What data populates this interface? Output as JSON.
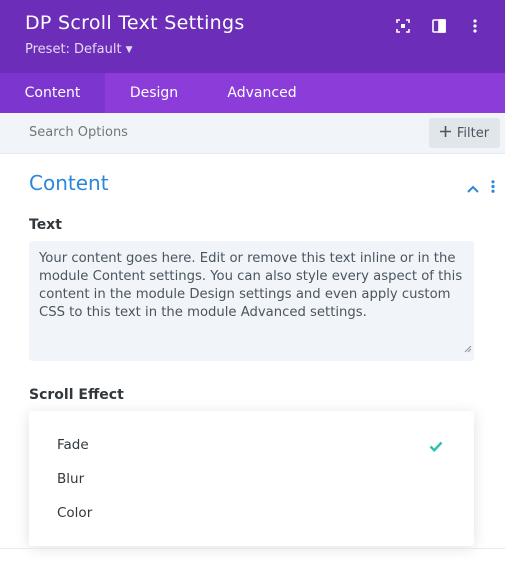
{
  "header": {
    "title": "DP Scroll Text Settings",
    "preset_label": "Preset: Default",
    "icons": [
      "expand-icon",
      "sidebar-toggle-icon",
      "more-vertical-icon"
    ]
  },
  "tabs": [
    {
      "label": "Content",
      "active": true
    },
    {
      "label": "Design",
      "active": false
    },
    {
      "label": "Advanced",
      "active": false
    }
  ],
  "search": {
    "placeholder": "Search Options",
    "filter_label": "Filter"
  },
  "section": {
    "title": "Content"
  },
  "text_field": {
    "label": "Text",
    "value": "Your content goes here. Edit or remove this text inline or in the module Content settings. You can also style every aspect of this content in the module Design settings and even apply custom CSS to this text in the module Advanced settings."
  },
  "scroll_effect": {
    "label": "Scroll Effect",
    "options": [
      "Fade",
      "Blur",
      "Color"
    ],
    "selected": "Fade"
  },
  "colors": {
    "header_bg": "#6c2eb9",
    "tabs_bg": "#8c3dd9",
    "active_tab_bg": "#7d35cf",
    "section_title": "#2b87da",
    "check": "#29c4a9"
  }
}
